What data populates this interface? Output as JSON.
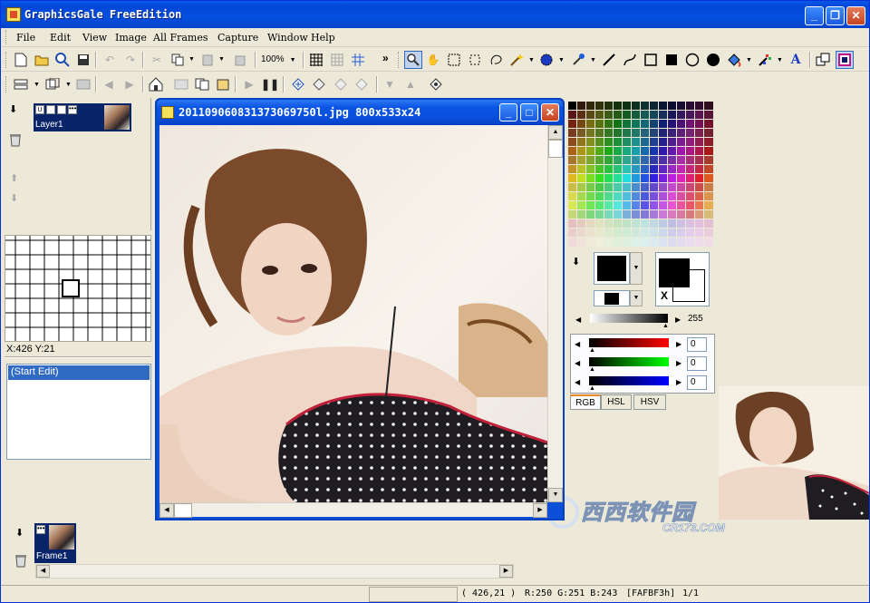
{
  "app": {
    "title": "GraphicsGale FreeEdition",
    "accent": "#0450e0"
  },
  "menu": [
    "File",
    "Edit",
    "View",
    "Image",
    "All Frames",
    "Capture",
    "Window",
    "Help"
  ],
  "toolbar": {
    "zoom_value": "100%",
    "more": "»",
    "tools": [
      "new-icon",
      "open-icon",
      "preview-icon",
      "save-icon",
      "undo-icon",
      "redo-icon",
      "cut-icon",
      "copy-icon",
      "paste-icon",
      "paste-new-icon",
      "grid-icon",
      "pixel-grid-icon",
      "select-grid-icon",
      "zoom-tool-icon",
      "hand-tool-icon",
      "rect-select-icon",
      "lasso-icon",
      "magic-wand-icon",
      "color-pick-icon",
      "color-select-icon",
      "pencil-icon",
      "line-icon",
      "curve-icon",
      "rect-icon",
      "filled-rect-icon",
      "ellipse-icon",
      "filled-ellipse-icon",
      "fill-icon",
      "gradient-icon",
      "text-tool-icon",
      "transparent-icon",
      "frame-color-icon"
    ]
  },
  "layer_panel": {
    "layer_name": "Layer1",
    "coords": "X:426 Y:21"
  },
  "history": {
    "items": [
      "(Start Edit)"
    ]
  },
  "frame_panel": {
    "frame_name": "Frame1"
  },
  "document": {
    "title": "201109060831373069750l.jpg  800x533x24"
  },
  "palette": {
    "gray_value": "255",
    "r_value": "0",
    "g_value": "0",
    "b_value": "0",
    "tabs": [
      "RGB",
      "HSL",
      "HSV"
    ],
    "fg_color": "#000000",
    "bg_color": "#ffffff",
    "x_label": "X"
  },
  "status": {
    "coord": "( 426,21 )",
    "rgb": "R:250 G:251 B:243",
    "hex": "[FAFBF3h]",
    "page": "1/1"
  },
  "watermark": {
    "text1": "西西软件园",
    "text2": "CR173.COM"
  }
}
